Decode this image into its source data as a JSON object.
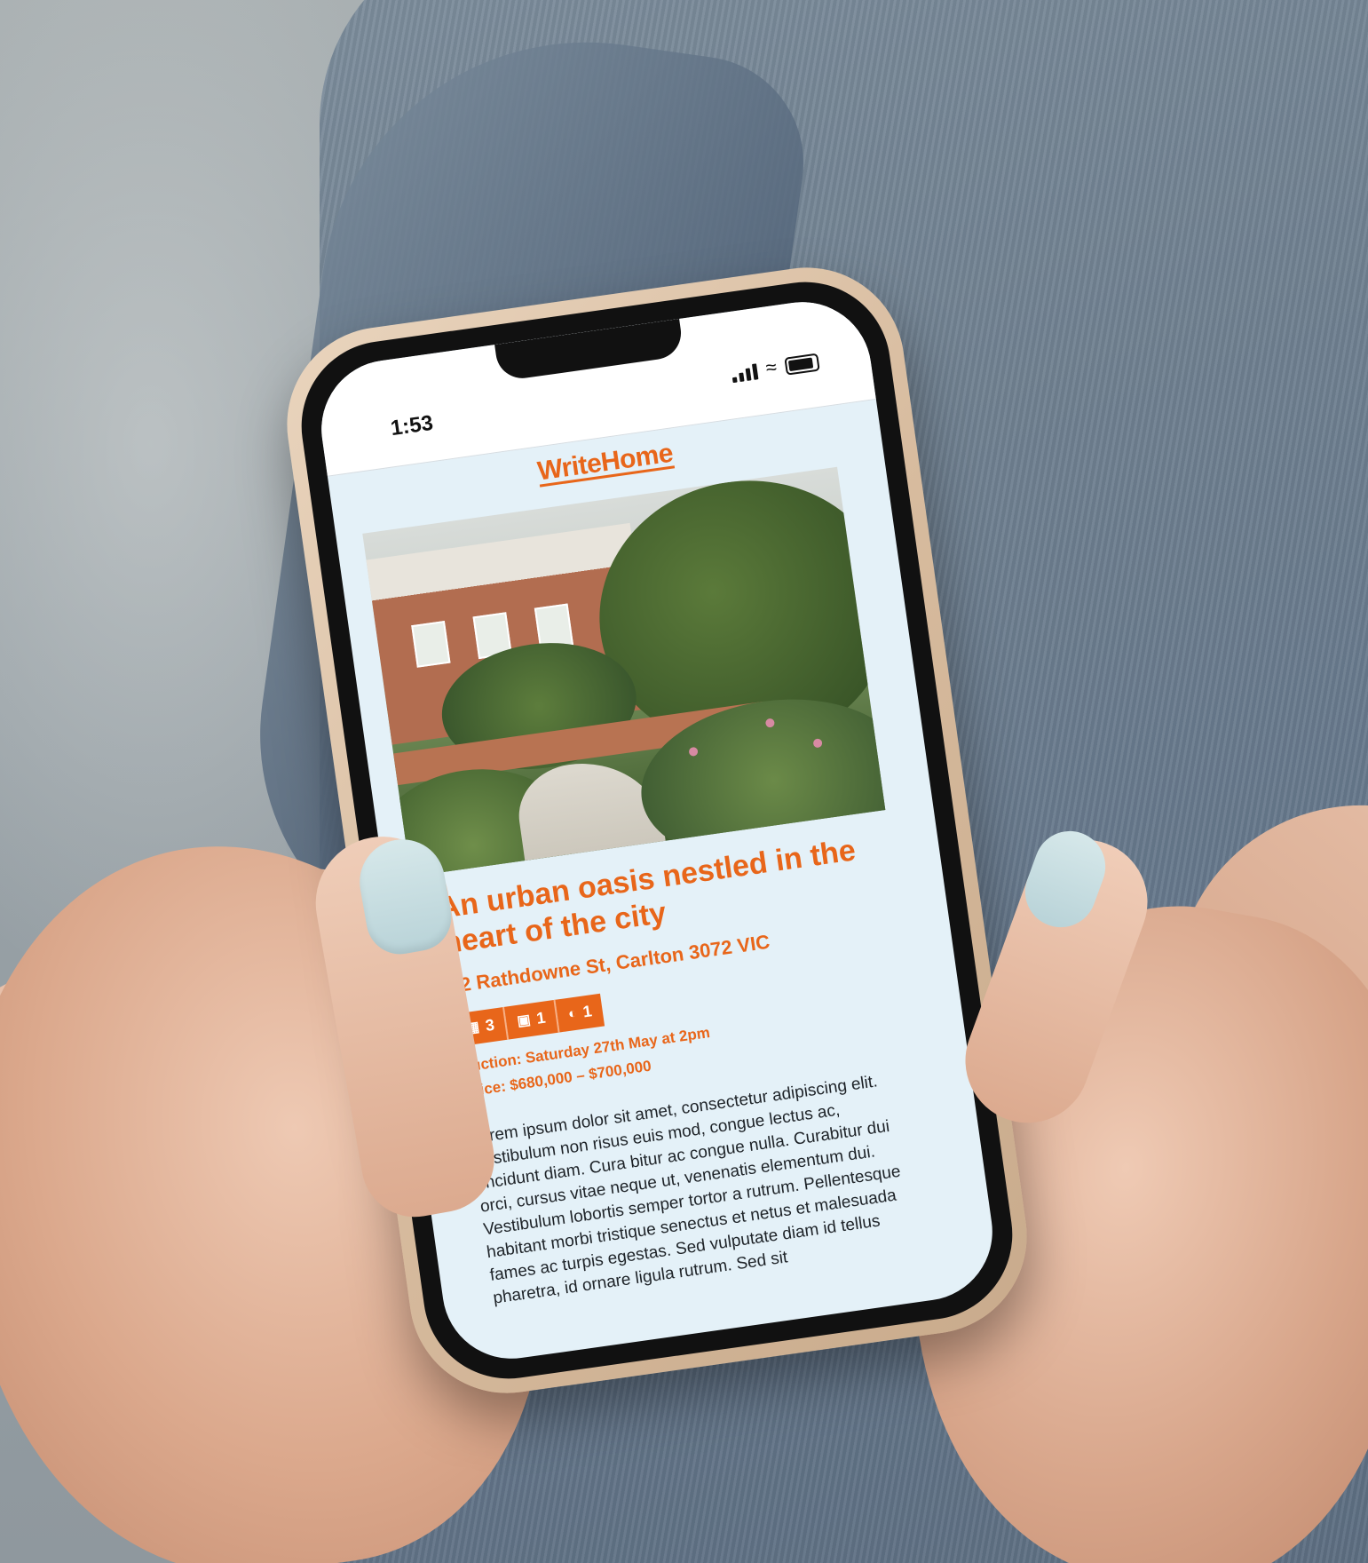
{
  "status_bar": {
    "time": "1:53"
  },
  "app": {
    "brand": "WriteHome"
  },
  "listing": {
    "title": "An urban oasis nestled in the heart of the city",
    "address": "42 Rathdowne St,  Carlton 3072 VIC",
    "features": [
      {
        "icon": "bed-icon",
        "count": "3"
      },
      {
        "icon": "car-icon",
        "count": "1"
      },
      {
        "icon": "bath-icon",
        "count": "1"
      }
    ],
    "auction": "Auction: Saturday 27th May at 2pm",
    "price": "Price: $680,000 – $700,000",
    "description": "Lorem ipsum dolor sit amet, consectetur adipiscing elit. Vestibulum non risus euis mod, congue lectus ac, tincidunt diam. Cura bitur ac congue nulla. Curabitur dui orci, cursus vitae neque ut, venenatis elementum dui. Vestibulum lobortis semper tortor a rutrum. Pellentesque habitant morbi tristique senectus et netus et malesuada fames ac turpis egestas. Sed vulputate diam id tellus pharetra, id ornare ligula rutrum. Sed sit"
  },
  "colors": {
    "accent": "#e8661a",
    "screen_bg": "#e4f1f8"
  }
}
